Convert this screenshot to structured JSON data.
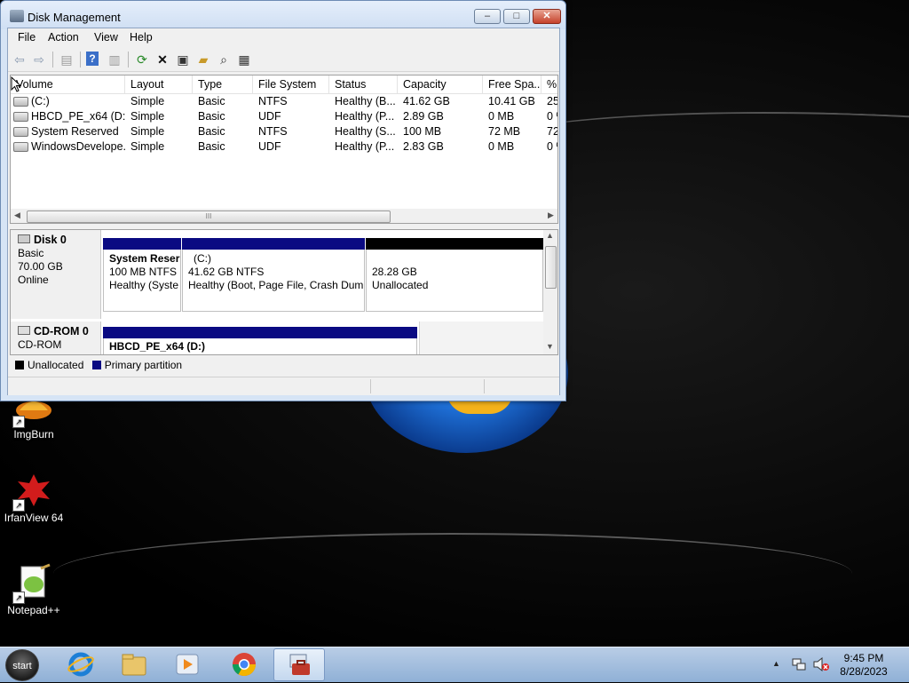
{
  "window": {
    "title": "Disk Management",
    "caption_min": "–",
    "caption_max": "□",
    "caption_close": "✕"
  },
  "menu": [
    "File",
    "Action",
    "View",
    "Help"
  ],
  "toolbar_icons": [
    "back-arrow-icon",
    "forward-arrow-icon",
    "console-tree-icon",
    "help-icon",
    "show-pane-icon",
    "refresh-icon",
    "delete-icon",
    "properties-icon",
    "open-icon",
    "search-icon",
    "rescan-icon"
  ],
  "volume_list": {
    "columns": [
      "Volume",
      "Layout",
      "Type",
      "File System",
      "Status",
      "Capacity",
      "Free Spa...",
      "% F"
    ],
    "rows": [
      [
        "(C:)",
        "Simple",
        "Basic",
        "NTFS",
        "Healthy (B...",
        "41.62 GB",
        "10.41 GB",
        "25"
      ],
      [
        "HBCD_PE_x64 (D:)",
        "Simple",
        "Basic",
        "UDF",
        "Healthy (P...",
        "2.89 GB",
        "0 MB",
        "0 %"
      ],
      [
        "System Reserved",
        "Simple",
        "Basic",
        "NTFS",
        "Healthy (S...",
        "100 MB",
        "72 MB",
        "72"
      ],
      [
        "WindowsDevelope...",
        "Simple",
        "Basic",
        "UDF",
        "Healthy (P...",
        "2.83 GB",
        "0 MB",
        "0 %"
      ]
    ],
    "scroll_grip": "III"
  },
  "disks": [
    {
      "name": "Disk 0",
      "type": "Basic",
      "size": "70.00 GB",
      "state": "Online",
      "partitions": [
        {
          "title": "System Reser",
          "line2": "100 MB NTFS",
          "line3": "Healthy (Syste",
          "bar_color": "#0a0a82"
        },
        {
          "title": "(C:)",
          "line2": "41.62 GB NTFS",
          "line3": "Healthy (Boot, Page File, Crash Dum",
          "bar_color": "#0a0a82"
        },
        {
          "title": "",
          "line2": "28.28 GB",
          "line3": "Unallocated",
          "bar_color": "#000000"
        }
      ]
    },
    {
      "name": "CD-ROM 0",
      "type": "CD-ROM",
      "partitions": [
        {
          "title": "HBCD_PE_x64  (D:)",
          "bar_color": "#0a0a82"
        }
      ]
    }
  ],
  "legend": [
    {
      "label": "Unallocated",
      "color": "#000000"
    },
    {
      "label": "Primary partition",
      "color": "#0a0a82"
    }
  ],
  "desktop_icons": [
    {
      "label": "ImgBurn"
    },
    {
      "label": "IrfanView 64"
    },
    {
      "label": "Notepad++"
    }
  ],
  "taskbar": {
    "start_label": "start",
    "clock_time": "9:45 PM",
    "clock_date": "8/28/2023",
    "tray_chevron": "▲"
  }
}
